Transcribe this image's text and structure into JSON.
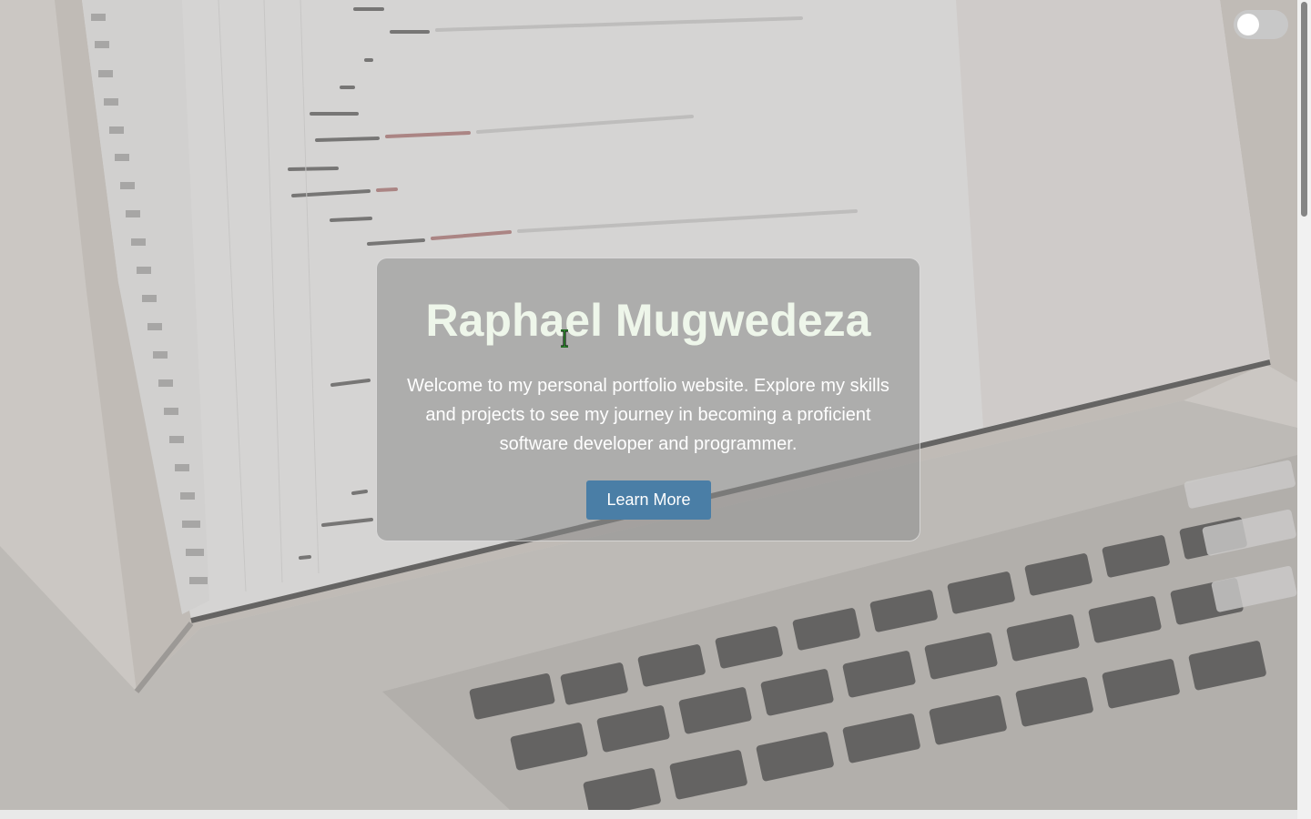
{
  "hero": {
    "background_image": "laptop-with-code-editor",
    "name": "Raphael Mugwedeza",
    "intro": "Welcome to my personal portfolio website. Explore my skills and projects to see my journey in becoming a proficient software developer and programmer.",
    "button_label": "Learn More"
  },
  "theme_toggle": {
    "state": "off"
  },
  "colors": {
    "card_title": "#eef6ea",
    "button_background": "#4a7ea6",
    "toggle_track": "#c8c8c8"
  }
}
